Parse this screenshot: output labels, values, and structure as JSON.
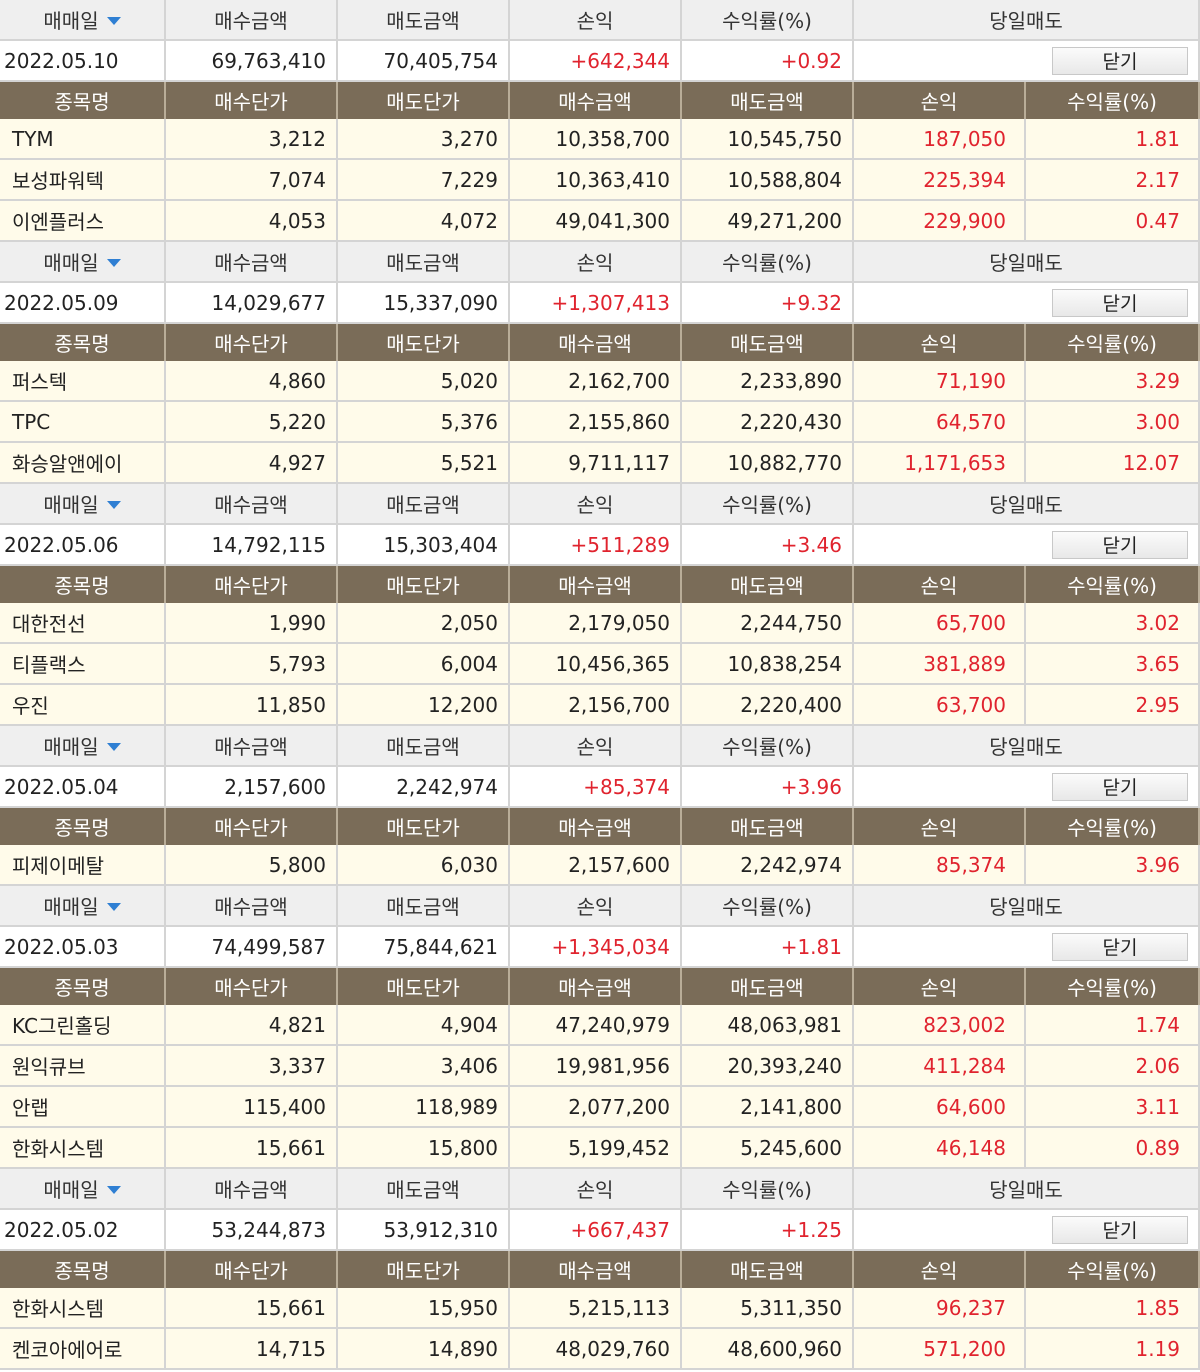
{
  "headers": {
    "trade_date": "매매일",
    "buy_total": "매수금액",
    "sell_total": "매도금액",
    "profit": "손익",
    "return_rate": "수익률(%)",
    "same_day_sell": "당일매도"
  },
  "sub_headers": {
    "name": "종목명",
    "buy_price": "매수단가",
    "sell_price": "매도단가",
    "buy_amount": "매수금액",
    "sell_amount": "매도금액",
    "profit": "손익",
    "return_rate": "수익률(%)"
  },
  "close_label": "닫기",
  "groups": [
    {
      "date": "2022.05.10",
      "buy_total": "69,763,410",
      "sell_total": "70,405,754",
      "profit": "+642,344",
      "rate": "+0.92",
      "items": [
        {
          "name": "TYM",
          "buy_price": "3,212",
          "sell_price": "3,270",
          "buy_amount": "10,358,700",
          "sell_amount": "10,545,750",
          "profit": "187,050",
          "rate": "1.81"
        },
        {
          "name": "보성파워텍",
          "buy_price": "7,074",
          "sell_price": "7,229",
          "buy_amount": "10,363,410",
          "sell_amount": "10,588,804",
          "profit": "225,394",
          "rate": "2.17"
        },
        {
          "name": "이엔플러스",
          "buy_price": "4,053",
          "sell_price": "4,072",
          "buy_amount": "49,041,300",
          "sell_amount": "49,271,200",
          "profit": "229,900",
          "rate": "0.47"
        }
      ]
    },
    {
      "date": "2022.05.09",
      "buy_total": "14,029,677",
      "sell_total": "15,337,090",
      "profit": "+1,307,413",
      "rate": "+9.32",
      "items": [
        {
          "name": "퍼스텍",
          "buy_price": "4,860",
          "sell_price": "5,020",
          "buy_amount": "2,162,700",
          "sell_amount": "2,233,890",
          "profit": "71,190",
          "rate": "3.29"
        },
        {
          "name": "TPC",
          "buy_price": "5,220",
          "sell_price": "5,376",
          "buy_amount": "2,155,860",
          "sell_amount": "2,220,430",
          "profit": "64,570",
          "rate": "3.00"
        },
        {
          "name": "화승알앤에이",
          "buy_price": "4,927",
          "sell_price": "5,521",
          "buy_amount": "9,711,117",
          "sell_amount": "10,882,770",
          "profit": "1,171,653",
          "rate": "12.07"
        }
      ]
    },
    {
      "date": "2022.05.06",
      "buy_total": "14,792,115",
      "sell_total": "15,303,404",
      "profit": "+511,289",
      "rate": "+3.46",
      "items": [
        {
          "name": "대한전선",
          "buy_price": "1,990",
          "sell_price": "2,050",
          "buy_amount": "2,179,050",
          "sell_amount": "2,244,750",
          "profit": "65,700",
          "rate": "3.02"
        },
        {
          "name": "티플랙스",
          "buy_price": "5,793",
          "sell_price": "6,004",
          "buy_amount": "10,456,365",
          "sell_amount": "10,838,254",
          "profit": "381,889",
          "rate": "3.65"
        },
        {
          "name": "우진",
          "buy_price": "11,850",
          "sell_price": "12,200",
          "buy_amount": "2,156,700",
          "sell_amount": "2,220,400",
          "profit": "63,700",
          "rate": "2.95"
        }
      ]
    },
    {
      "date": "2022.05.04",
      "buy_total": "2,157,600",
      "sell_total": "2,242,974",
      "profit": "+85,374",
      "rate": "+3.96",
      "items": [
        {
          "name": "피제이메탈",
          "buy_price": "5,800",
          "sell_price": "6,030",
          "buy_amount": "2,157,600",
          "sell_amount": "2,242,974",
          "profit": "85,374",
          "rate": "3.96"
        }
      ]
    },
    {
      "date": "2022.05.03",
      "buy_total": "74,499,587",
      "sell_total": "75,844,621",
      "profit": "+1,345,034",
      "rate": "+1.81",
      "items": [
        {
          "name": "KC그린홀딩",
          "buy_price": "4,821",
          "sell_price": "4,904",
          "buy_amount": "47,240,979",
          "sell_amount": "48,063,981",
          "profit": "823,002",
          "rate": "1.74"
        },
        {
          "name": "원익큐브",
          "buy_price": "3,337",
          "sell_price": "3,406",
          "buy_amount": "19,981,956",
          "sell_amount": "20,393,240",
          "profit": "411,284",
          "rate": "2.06"
        },
        {
          "name": "안랩",
          "buy_price": "115,400",
          "sell_price": "118,989",
          "buy_amount": "2,077,200",
          "sell_amount": "2,141,800",
          "profit": "64,600",
          "rate": "3.11"
        },
        {
          "name": "한화시스템",
          "buy_price": "15,661",
          "sell_price": "15,800",
          "buy_amount": "5,199,452",
          "sell_amount": "5,245,600",
          "profit": "46,148",
          "rate": "0.89"
        }
      ]
    },
    {
      "date": "2022.05.02",
      "buy_total": "53,244,873",
      "sell_total": "53,912,310",
      "profit": "+667,437",
      "rate": "+1.25",
      "items": [
        {
          "name": "한화시스템",
          "buy_price": "15,661",
          "sell_price": "15,950",
          "buy_amount": "5,215,113",
          "sell_amount": "5,311,350",
          "profit": "96,237",
          "rate": "1.85"
        },
        {
          "name": "켄코아에어로",
          "buy_price": "14,715",
          "sell_price": "14,890",
          "buy_amount": "48,029,760",
          "sell_amount": "48,600,960",
          "profit": "571,200",
          "rate": "1.19"
        }
      ]
    }
  ]
}
